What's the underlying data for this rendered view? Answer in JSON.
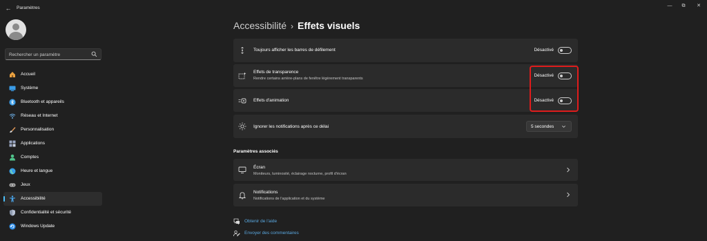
{
  "window": {
    "app_title": "Paramètres",
    "back": "←",
    "minimize": "—",
    "maximize": "⧉",
    "close": "✕"
  },
  "sidebar": {
    "search": {
      "placeholder": "Rechercher un paramètre"
    },
    "items": [
      {
        "label": "Accueil",
        "icon": "home-icon",
        "color": "#e8a040"
      },
      {
        "label": "Système",
        "icon": "system-icon",
        "color": "#3a9be6"
      },
      {
        "label": "Bluetooth et appareils",
        "icon": "bluetooth-icon",
        "color": "#3a9be6"
      },
      {
        "label": "Réseau et Internet",
        "icon": "network-icon",
        "color": "#6fb4ee"
      },
      {
        "label": "Personnalisation",
        "icon": "brush-icon",
        "color": "#e59a58"
      },
      {
        "label": "Applications",
        "icon": "apps-icon",
        "color": "#9aa6c2"
      },
      {
        "label": "Comptes",
        "icon": "accounts-icon",
        "color": "#4fc28a"
      },
      {
        "label": "Heure et langue",
        "icon": "globe-icon",
        "color": "#38a0e8"
      },
      {
        "label": "Jeux",
        "icon": "gamepad-icon",
        "color": "#b0b0b0"
      },
      {
        "label": "Accessibilité",
        "icon": "accessibility-icon",
        "color": "#4aa8f0",
        "active": true
      },
      {
        "label": "Confidentialité et sécurité",
        "icon": "shield-icon",
        "color": "#8f9bb0"
      },
      {
        "label": "Windows Update",
        "icon": "update-icon",
        "color": "#2f8ee8"
      }
    ]
  },
  "breadcrumb": {
    "parent": "Accessibilité",
    "separator": "›",
    "current": "Effets visuels"
  },
  "settings": [
    {
      "title": "Toujours afficher les barres de défilement",
      "state": "Désactivé",
      "icon": "scrollbar-icon"
    },
    {
      "title": "Effets de transparence",
      "subtitle": "Rendre certains arrière-plans de fenêtre légèrement transparents",
      "state": "Désactivé",
      "icon": "transparency-icon"
    },
    {
      "title": "Effets d'animation",
      "state": "Désactivé",
      "icon": "animation-icon"
    },
    {
      "title": "Ignorer les notifications après ce délai",
      "icon": "brightness-icon",
      "dropdown_value": "5 secondes"
    }
  ],
  "related": {
    "heading": "Paramètres associés",
    "items": [
      {
        "title": "Écran",
        "subtitle": "Moniteurs, luminosité, éclairage nocturne, profil d'écran",
        "icon": "monitor-icon"
      },
      {
        "title": "Notifications",
        "subtitle": "Notifications de l'application et du système",
        "icon": "bell-icon"
      }
    ]
  },
  "links": [
    {
      "label": "Obtenir de l'aide",
      "icon": "help-icon"
    },
    {
      "label": "Envoyer des commentaires",
      "icon": "feedback-icon"
    }
  ],
  "colors": {
    "accent": "#4cc2ff",
    "link": "#5aa8e0",
    "highlight": "#e01c1c"
  }
}
